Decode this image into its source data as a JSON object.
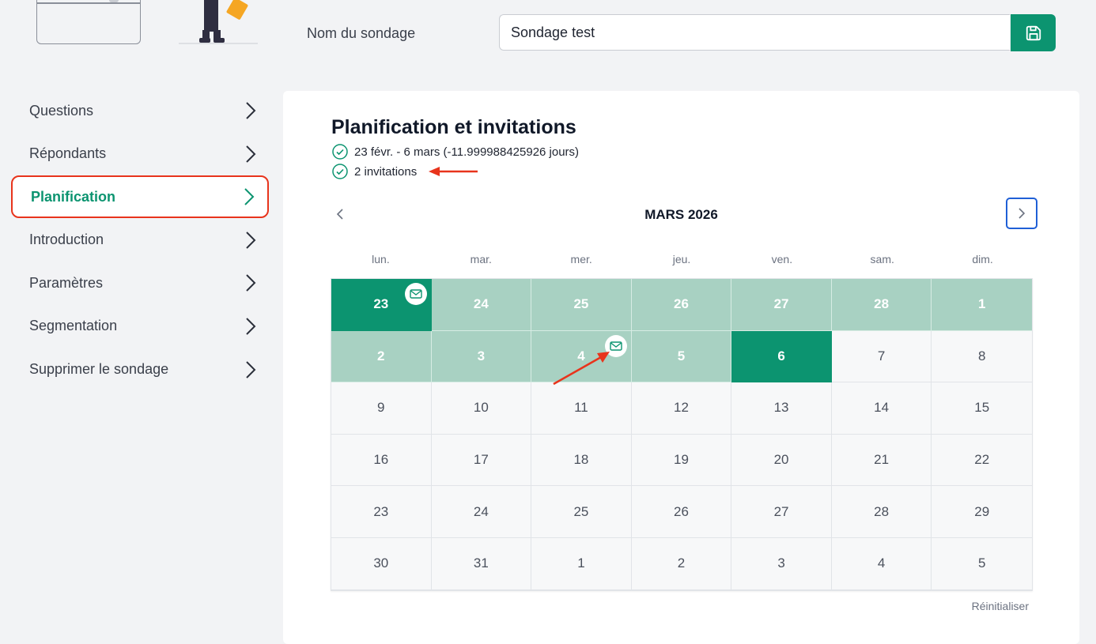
{
  "header": {
    "survey_name_label": "Nom du sondage",
    "survey_name_value": "Sondage test",
    "save_icon": "save-icon"
  },
  "sidebar": {
    "items": [
      {
        "label": "Questions",
        "active": false
      },
      {
        "label": "Répondants",
        "active": false
      },
      {
        "label": "Planification",
        "active": true
      },
      {
        "label": "Introduction",
        "active": false
      },
      {
        "label": "Paramètres",
        "active": false
      },
      {
        "label": "Segmentation",
        "active": false
      },
      {
        "label": "Supprimer le sondage",
        "active": false
      }
    ]
  },
  "main": {
    "title": "Planification et invitations",
    "date_range": "23 févr. - 6 mars (-11.999988425926 jours)",
    "invitations": "2 invitations",
    "calendar": {
      "month_label": "MARS 2026",
      "weekdays": [
        "lun.",
        "mar.",
        "mer.",
        "jeu.",
        "ven.",
        "sam.",
        "dim."
      ],
      "days": [
        {
          "n": "23",
          "state": "edge",
          "mail": true
        },
        {
          "n": "24",
          "state": "inrange"
        },
        {
          "n": "25",
          "state": "inrange"
        },
        {
          "n": "26",
          "state": "inrange"
        },
        {
          "n": "27",
          "state": "inrange"
        },
        {
          "n": "28",
          "state": "inrange"
        },
        {
          "n": "1",
          "state": "inrange"
        },
        {
          "n": "2",
          "state": "inrange"
        },
        {
          "n": "3",
          "state": "inrange"
        },
        {
          "n": "4",
          "state": "inrange",
          "mail": true
        },
        {
          "n": "5",
          "state": "inrange"
        },
        {
          "n": "6",
          "state": "edge"
        },
        {
          "n": "7"
        },
        {
          "n": "8"
        },
        {
          "n": "9"
        },
        {
          "n": "10"
        },
        {
          "n": "11"
        },
        {
          "n": "12"
        },
        {
          "n": "13"
        },
        {
          "n": "14"
        },
        {
          "n": "15"
        },
        {
          "n": "16"
        },
        {
          "n": "17"
        },
        {
          "n": "18"
        },
        {
          "n": "19"
        },
        {
          "n": "20"
        },
        {
          "n": "21"
        },
        {
          "n": "22"
        },
        {
          "n": "23"
        },
        {
          "n": "24"
        },
        {
          "n": "25"
        },
        {
          "n": "26"
        },
        {
          "n": "27"
        },
        {
          "n": "28"
        },
        {
          "n": "29"
        },
        {
          "n": "30"
        },
        {
          "n": "31"
        },
        {
          "n": "1"
        },
        {
          "n": "2"
        },
        {
          "n": "3"
        },
        {
          "n": "4"
        },
        {
          "n": "5"
        }
      ]
    },
    "reset_label": "Réinitialiser"
  },
  "colors": {
    "accent": "#0c9470",
    "range": "#a8d1c2",
    "highlight": "#e8341c",
    "focus": "#1f5fd6"
  }
}
